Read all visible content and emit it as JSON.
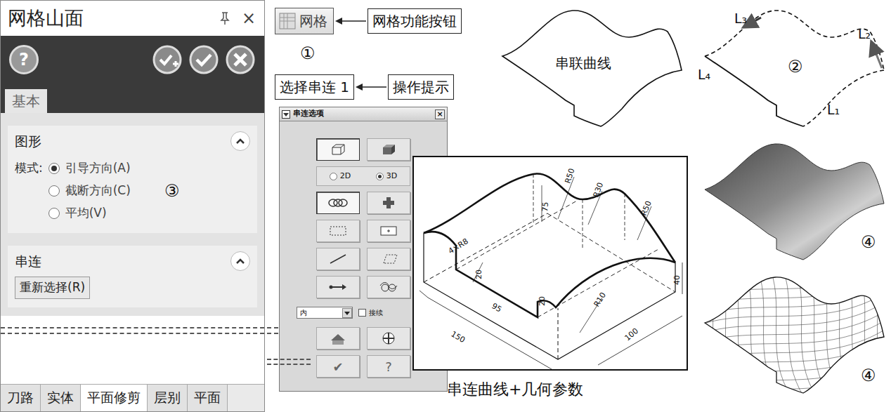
{
  "panel": {
    "title": "网格山面",
    "close": "×",
    "help": "?",
    "tabs": [
      {
        "label": "基本",
        "selected": true
      }
    ],
    "sections": [
      {
        "title": "图形",
        "expanded": true,
        "mode_label": "模式:",
        "options": [
          {
            "label": "引导方向(A)",
            "selected": true
          },
          {
            "label": "截断方向(C)",
            "selected": false
          },
          {
            "label": "平均(V)",
            "selected": false
          }
        ]
      },
      {
        "title": "串连",
        "expanded": true,
        "button": "重新选择(R)"
      }
    ],
    "marker": "③",
    "bottom_tabs": [
      {
        "label": "刀路",
        "selected": false
      },
      {
        "label": "实体",
        "selected": false
      },
      {
        "label": "平面修剪",
        "selected": true
      },
      {
        "label": "层别",
        "selected": false
      },
      {
        "label": "平面",
        "selected": false
      }
    ]
  },
  "mesh_button": {
    "label": "网格",
    "annotation": "网格功能按钮",
    "marker": "①"
  },
  "prompt": {
    "label": "选择串连 1",
    "annotation": "操作提示"
  },
  "chain_dialog": {
    "title": "串连选项",
    "close": "×",
    "tools_top": [
      {
        "kind": "wireframe",
        "selected": true
      },
      {
        "kind": "solid",
        "selected": false
      }
    ],
    "dims": [
      {
        "label": "2D",
        "selected": false
      },
      {
        "label": "3D",
        "selected": true
      }
    ],
    "tools_mid": [
      {
        "kind": "chain",
        "selected": true
      },
      {
        "kind": "point",
        "selected": false
      },
      {
        "kind": "window",
        "selected": false
      },
      {
        "kind": "area",
        "selected": false
      },
      {
        "kind": "single",
        "selected": false
      },
      {
        "kind": "polygon",
        "selected": false
      },
      {
        "kind": "vector",
        "selected": false
      },
      {
        "kind": "partial",
        "selected": false
      }
    ],
    "select": "内",
    "checkbox": {
      "label": "接续",
      "checked": false
    },
    "tools_bottom": [
      {
        "kind": "previous",
        "selected": false
      },
      {
        "kind": "options",
        "selected": false
      }
    ],
    "ok": "✔",
    "help": "?"
  },
  "drawing": {
    "labels": [
      "R50",
      "R30",
      "75",
      "R50",
      "4×R8",
      "20",
      "20",
      "95",
      "150",
      "100",
      "40",
      "R10"
    ],
    "caption": "串连曲线+几何参数"
  },
  "curve_view": {
    "title": "串联曲线"
  },
  "chain_view": {
    "marker": "②",
    "labels": [
      "L₃",
      "L₂",
      "L₄",
      "L₁"
    ]
  },
  "results": [
    {
      "kind": "shaded",
      "marker": "④"
    },
    {
      "kind": "wireframe",
      "marker": "④"
    }
  ]
}
